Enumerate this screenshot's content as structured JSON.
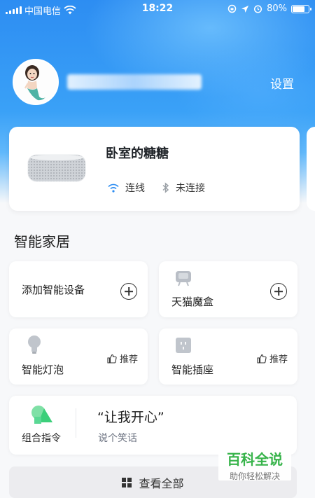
{
  "status_bar": {
    "carrier": "中国电信",
    "time": "18:22",
    "battery": "80%",
    "battery_level": 0.8
  },
  "profile": {
    "username": " ",
    "settings_label": "设置"
  },
  "device_card": {
    "title": "卧室的糖糖",
    "wifi_label": "连线",
    "bluetooth_label": "未连接"
  },
  "smart_home": {
    "title": "智能家居",
    "add_device_label": "添加智能设备",
    "tmall_box_label": "天猫魔盒",
    "bulb_label": "智能灯泡",
    "bulb_recommend": "推荐",
    "socket_label": "智能插座",
    "socket_recommend": "推荐",
    "combo_label": "组合指令",
    "combo_quote": "“让我开心”",
    "combo_sub": "说个笑话",
    "view_all_label": "查看全部"
  },
  "watermark": {
    "title": "百科全说",
    "subtitle": "助你轻松解决"
  },
  "colors": {
    "accent_blue": "#2d8df2",
    "watermark_green": "#37b34a",
    "combo_green": "#3ccf7a"
  }
}
